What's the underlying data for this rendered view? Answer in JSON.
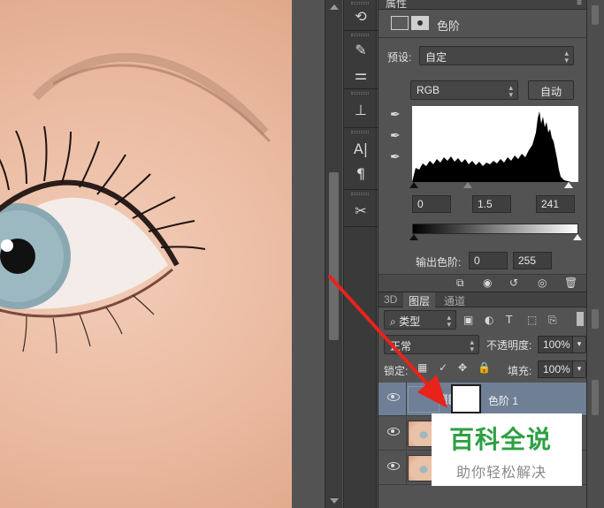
{
  "properties": {
    "tab_label": "属性",
    "adjustment_title": "色阶",
    "preset_label": "预设:",
    "preset_value": "自定",
    "channel_value": "RGB",
    "auto_label": "自动",
    "input_black": "0",
    "input_gamma": "1.5",
    "input_white": "241",
    "output_label": "输出色阶:",
    "output_black": "0",
    "output_white": "255"
  },
  "layers_panel": {
    "tabs": [
      "3D",
      "图层",
      "通道"
    ],
    "filter_kind": "类型",
    "blend_mode": "正常",
    "opacity_label": "不透明度:",
    "opacity_value": "100%",
    "lock_label": "锁定:",
    "fill_label": "填充:",
    "fill_value": "100%",
    "layers": [
      {
        "name": "色阶 1",
        "type": "adjustment-levels",
        "selected": true
      },
      {
        "name": "",
        "type": "image",
        "selected": false
      },
      {
        "name": "",
        "type": "image",
        "selected": false
      }
    ]
  },
  "watermark": {
    "title": "百科全说",
    "subtitle": "助你轻松解决"
  },
  "colors": {
    "selected_layer": "#6f7f96",
    "arrow": "#e8231b",
    "watermark_green": "#2ea043"
  }
}
